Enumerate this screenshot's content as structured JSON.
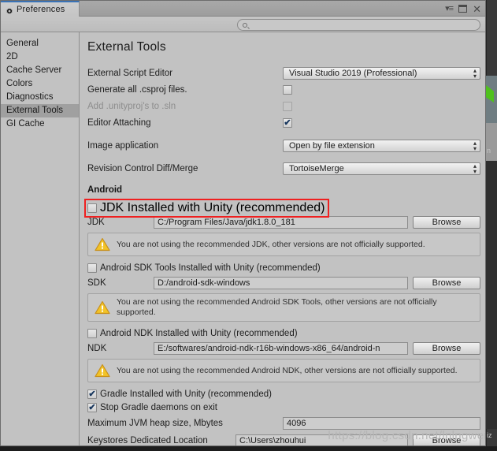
{
  "window": {
    "tab_title": "Preferences",
    "tab_icon": "gear-icon",
    "controls": {
      "menu": "▾≡",
      "maximize": "maximize-icon",
      "close": "✕"
    }
  },
  "search": {
    "value": "",
    "placeholder": "",
    "icon": "search-icon"
  },
  "sidebar": {
    "items": [
      {
        "label": "General",
        "selected": false
      },
      {
        "label": "2D",
        "selected": false
      },
      {
        "label": "Cache Server",
        "selected": false
      },
      {
        "label": "Colors",
        "selected": false
      },
      {
        "label": "Diagnostics",
        "selected": false
      },
      {
        "label": "External Tools",
        "selected": true
      },
      {
        "label": "GI Cache",
        "selected": false
      }
    ]
  },
  "main": {
    "title": "External Tools",
    "script_editor": {
      "label": "External Script Editor",
      "value": "Visual Studio 2019 (Professional)"
    },
    "generate_csproj": {
      "label": "Generate all .csproj files.",
      "checked": false
    },
    "add_unityproj": {
      "label": "Add .unityproj's to .sln",
      "checked": false,
      "disabled": true
    },
    "editor_attaching": {
      "label": "Editor Attaching",
      "checked": true
    },
    "image_application": {
      "label": "Image application",
      "value": "Open by file extension"
    },
    "revision_control": {
      "label": "Revision Control Diff/Merge",
      "value": "TortoiseMerge"
    },
    "android_section": "Android",
    "jdk": {
      "checkbox_label": "JDK Installed with Unity (recommended)",
      "checked": false,
      "highlighted": true,
      "path_label": "JDK",
      "path_value": "C:/Program Files/Java/jdk1.8.0_181",
      "browse_label": "Browse",
      "warning": "You are not using the recommended JDK, other versions are not officially supported."
    },
    "sdk": {
      "checkbox_label": "Android SDK Tools Installed with Unity (recommended)",
      "checked": false,
      "path_label": "SDK",
      "path_value": "D:/android-sdk-windows",
      "browse_label": "Browse",
      "warning": "You are not using the recommended Android SDK Tools, other versions are not officially supported."
    },
    "ndk": {
      "checkbox_label": "Android NDK Installed with Unity (recommended)",
      "checked": false,
      "path_label": "NDK",
      "path_value": "E:/softwares/android-ndk-r16b-windows-x86_64/android-n",
      "browse_label": "Browse",
      "warning": "You are not using the recommended Android NDK, other versions are not officially supported."
    },
    "gradle_installed": {
      "label": "Gradle Installed with Unity (recommended)",
      "checked": true
    },
    "stop_gradle": {
      "label": "Stop Gradle daemons on exit",
      "checked": true
    },
    "jvm_heap": {
      "label": "Maximum JVM heap size, Mbytes",
      "value": "4096"
    },
    "keystores": {
      "label": "Keystores Dedicated Location",
      "value": "C:\\Users\\zhouhui",
      "browse_label": "Browse"
    }
  },
  "watermark": "https://blog.csdn.net/lnlngwei",
  "backdrop": {
    "label_n": "n",
    "label_iz": "iz"
  },
  "colors": {
    "highlight_red": "#ef2020",
    "tab_accent": "#3a72b5",
    "warning_yellow": "#f2c327",
    "window_bg": "#c2c2c2",
    "selected_item": "#a0a0a0"
  }
}
